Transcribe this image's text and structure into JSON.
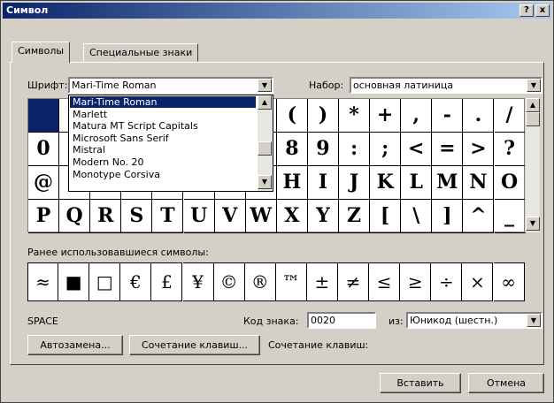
{
  "window": {
    "title": "Символ",
    "help_btn": "?",
    "close_btn": "x"
  },
  "tabs": [
    {
      "label": "Символы",
      "active": true
    },
    {
      "label": "Специальные знаки",
      "active": false
    }
  ],
  "font": {
    "label": "Шрифт:",
    "value": "Mari-Time Roman"
  },
  "subset": {
    "label": "Набор:",
    "value": "основная латиница"
  },
  "font_dropdown": {
    "options": [
      "Mari-Time Roman",
      "Marlett",
      "Matura MT Script Capitals",
      "Microsoft Sans Serif",
      "Mistral",
      "Modern No. 20",
      "Monotype Corsiva"
    ],
    "selected": "Mari-Time Roman"
  },
  "symbol_grid": {
    "rows": [
      [
        "",
        "",
        "",
        "",
        "",
        "",
        "",
        "",
        "(",
        ")",
        "*",
        "+",
        ",",
        "-",
        ".",
        "/"
      ],
      [
        "0",
        "",
        "",
        "",
        "",
        "",
        "",
        "",
        "8",
        "9",
        ":",
        ";",
        "<",
        "=",
        ">",
        "?"
      ],
      [
        "@",
        "",
        "",
        "",
        "",
        "",
        "",
        "",
        "H",
        "I",
        "J",
        "K",
        "L",
        "M",
        "N",
        "O"
      ],
      [
        "P",
        "Q",
        "R",
        "S",
        "T",
        "U",
        "V",
        "W",
        "X",
        "Y",
        "Z",
        "[",
        "\\",
        "]",
        "^",
        "_"
      ]
    ]
  },
  "recent": {
    "label": "Ранее использовавшиеся символы:",
    "symbols": [
      "≈",
      "■",
      "□",
      "€",
      "£",
      "¥",
      "©",
      "®",
      "™",
      "±",
      "≠",
      "≤",
      "≥",
      "÷",
      "×",
      "∞"
    ]
  },
  "char_name": "SPACE",
  "code": {
    "label": "Код знака:",
    "value": "0020"
  },
  "from": {
    "label": "из:",
    "value": "Юникод (шестн.)"
  },
  "buttons": {
    "autocorrect": "Автозамена...",
    "shortcut_key": "Сочетание клавиш...",
    "shortcut_label": "Сочетание клавиш:",
    "insert": "Вставить",
    "cancel": "Отмена"
  },
  "icons": {
    "dropdown_arrow": "▼",
    "scroll_up": "▲",
    "scroll_down": "▼"
  }
}
